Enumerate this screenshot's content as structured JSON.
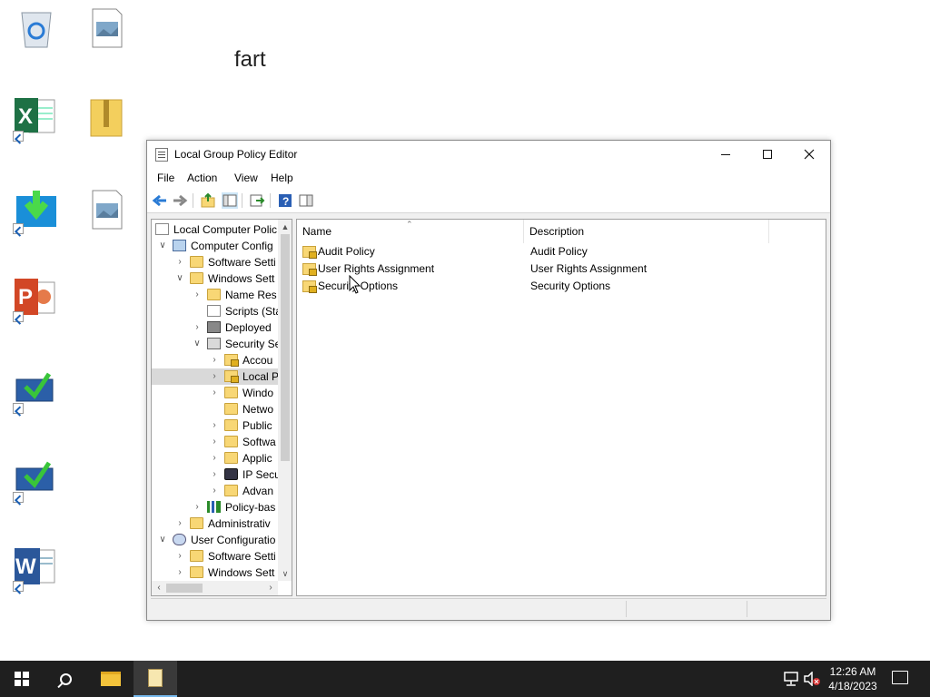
{
  "desktop": {
    "label_text": "fart",
    "icons": [
      {
        "name": "recycle-bin-icon"
      },
      {
        "name": "image-file-icon"
      },
      {
        "name": "excel-shortcut-icon"
      },
      {
        "name": "zip-folder-icon"
      },
      {
        "name": "download-shortcut-icon"
      },
      {
        "name": "image-file-icon-2"
      },
      {
        "name": "powerpoint-shortcut-icon"
      },
      {
        "name": "computer-shortcut-icon"
      },
      {
        "name": "computer-shortcut-icon-2"
      },
      {
        "name": "word-shortcut-icon"
      }
    ]
  },
  "window": {
    "title": "Local Group Policy Editor",
    "menu": [
      "File",
      "Action",
      "View",
      "Help"
    ]
  },
  "tree": {
    "items": [
      {
        "label": "Local Computer Polic"
      },
      {
        "label": "Computer Config"
      },
      {
        "label": "Software Setti"
      },
      {
        "label": "Windows Sett"
      },
      {
        "label": "Name Res"
      },
      {
        "label": "Scripts (Sta"
      },
      {
        "label": "Deployed"
      },
      {
        "label": "Security Se"
      },
      {
        "label": "Accou"
      },
      {
        "label": "Local P"
      },
      {
        "label": "Windo"
      },
      {
        "label": "Netwo"
      },
      {
        "label": "Public"
      },
      {
        "label": "Softwa"
      },
      {
        "label": "Applic"
      },
      {
        "label": "IP Secu"
      },
      {
        "label": "Advan"
      },
      {
        "label": "Policy-bas"
      },
      {
        "label": "Administrativ"
      },
      {
        "label": "User Configuratio"
      },
      {
        "label": "Software Setti"
      },
      {
        "label": "Windows Sett"
      }
    ]
  },
  "list": {
    "columns": {
      "name": "Name",
      "description": "Description"
    },
    "rows": [
      {
        "name": "Audit Policy",
        "description": "Audit Policy"
      },
      {
        "name": "User Rights Assignment",
        "description": "User Rights Assignment"
      },
      {
        "name": "Security Options",
        "description": "Security Options"
      }
    ]
  },
  "taskbar": {
    "time": "12:26 AM",
    "date": "4/18/2023"
  },
  "colors": {
    "taskbar": "#1f1f1f",
    "folder": "#f8d775",
    "accent": "#76b9ed"
  }
}
